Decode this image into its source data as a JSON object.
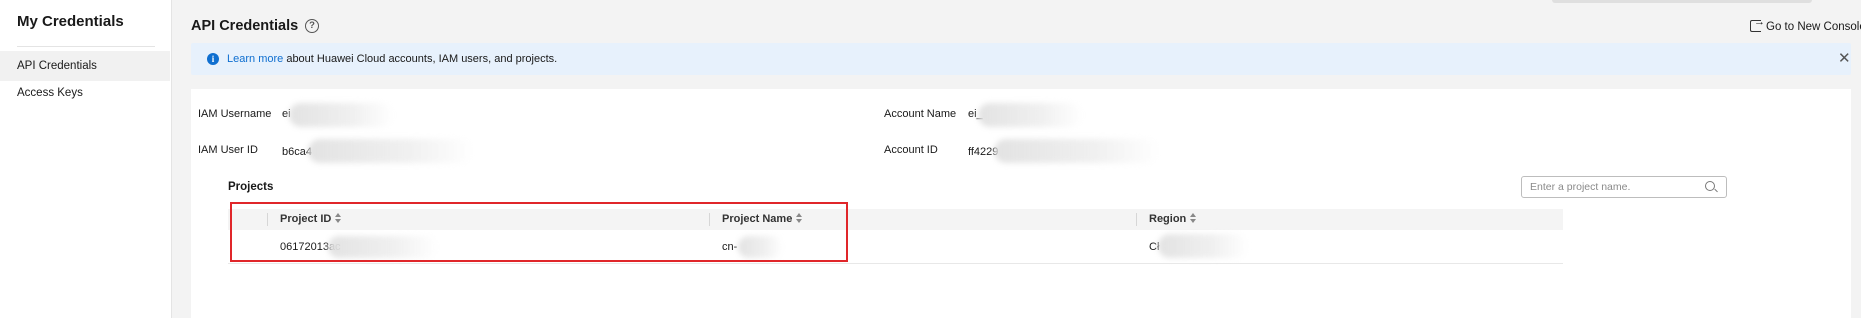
{
  "sidebar": {
    "title": "My Credentials",
    "items": [
      {
        "label": "API Credentials",
        "active": true
      },
      {
        "label": "Access Keys",
        "active": false
      }
    ]
  },
  "header": {
    "title": "API Credentials",
    "help_icon": "question-circle-icon",
    "new_console_label": "Go to New Console"
  },
  "banner": {
    "link_text": "Learn more",
    "text": " about Huawei Cloud accounts, IAM users, and projects.",
    "icon": "info-icon",
    "background": "#e7f1fc"
  },
  "account": {
    "iam_username_label": "IAM Username",
    "iam_username_value": "ei",
    "iam_user_id_label": "IAM User ID",
    "iam_user_id_value": "b6ca4",
    "account_name_label": "Account Name",
    "account_name_value": "ei_",
    "account_id_label": "Account ID",
    "account_id_value": "ff4229"
  },
  "projects": {
    "title": "Projects",
    "search_placeholder": "Enter a project name.",
    "columns": [
      "Project ID",
      "Project Name",
      "Region"
    ],
    "rows": [
      {
        "project_id": "06172013ac",
        "project_name": "cn-",
        "region": "Cł"
      }
    ]
  },
  "colors": {
    "link": "#0f6fd0",
    "highlight_border": "#e0262a"
  }
}
